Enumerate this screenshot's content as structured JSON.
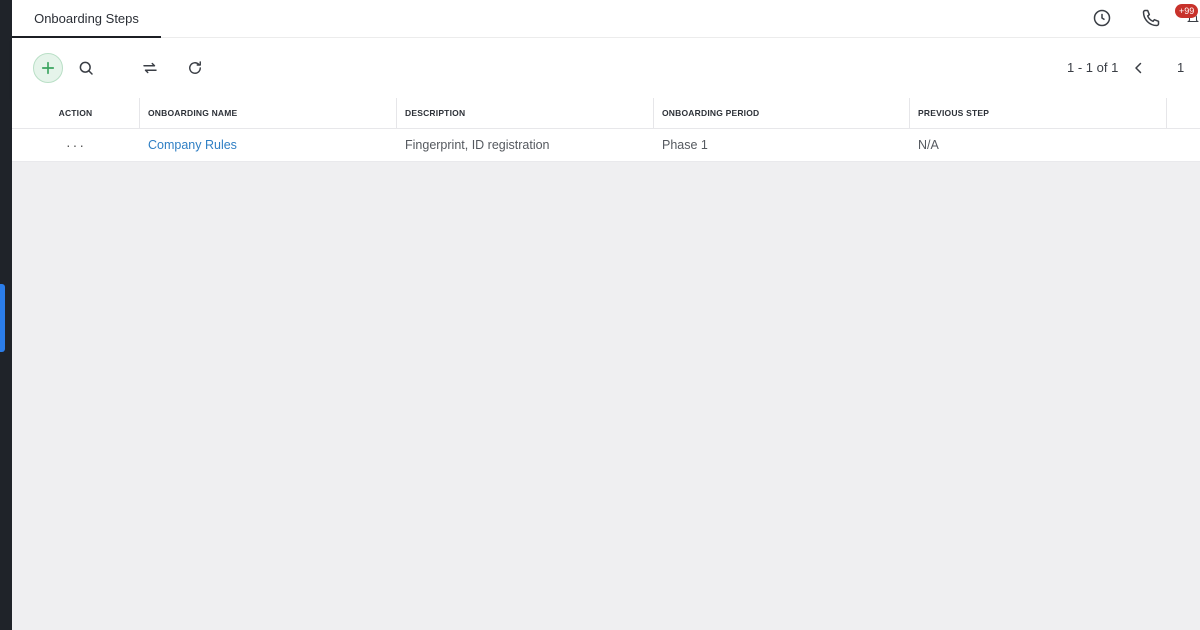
{
  "header": {
    "tab_title": "Onboarding Steps",
    "notification_badge": "+99",
    "icons": [
      "clock-icon",
      "phone-icon",
      "notification-icon"
    ]
  },
  "toolbar": {
    "icons": [
      "plus-icon",
      "search-icon",
      "swap-icon",
      "refresh-icon"
    ],
    "pagination_text": "1 - 1 of 1",
    "current_page": "1"
  },
  "table": {
    "columns": [
      "ACTION",
      "ONBOARDING NAME",
      "DESCRIPTION",
      "ONBOARDING PERIOD",
      "PREVIOUS STEP"
    ],
    "rows": [
      {
        "action": "···",
        "name": "Company Rules",
        "description": "Fingerprint, ID registration",
        "period": "Phase 1",
        "previous_step": "N/A"
      }
    ]
  },
  "colors": {
    "accent_blue": "#2b7de9",
    "link_blue": "#2f7fc4",
    "add_green": "#3aa45f",
    "badge_red": "#c8322b"
  }
}
